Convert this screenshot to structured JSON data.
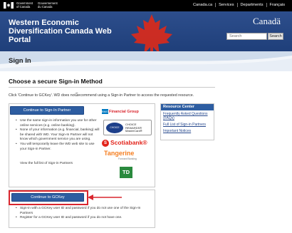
{
  "gov": {
    "en_line1": "Government",
    "en_line2": "of Canada",
    "fr_line1": "Gouvernement",
    "fr_line2": "du Canada",
    "links": [
      "Canada.ca",
      "Services",
      "Departments",
      "Français"
    ]
  },
  "banner": {
    "title": "Western Economic Diversification Canada Web Portal",
    "wordmark": "Canadä",
    "search_placeholder": "Search",
    "search_button": "Search"
  },
  "page": {
    "heading": "Sign In",
    "subtitle": "Choose a secure Sign-in Method",
    "intro": "Click 'Continue to GCKey'. WD does not recommend using a Sign-in Partner to access the requested resource."
  },
  "partner_panel": {
    "button": "Continue to Sign-In Partner",
    "bullets": [
      "Use the same sign-in information you use for other online services (e.g. online banking).",
      "None of your information (e.g. financial, banking) will be shared with WD. Your Sign-In Partner will not know which government service you are using.",
      "You will temporarily leave the WD web site to use your Sign-in Partner."
    ],
    "view_list": "View the full list of Sign-in Partners",
    "logos": {
      "bmo_mark": "BMO",
      "bmo_name": "Financial Group",
      "choice_disc": "CHOICE REWARDS",
      "choice_text": "CHOICE REWARDS® MasterCard®",
      "scotia": "Scotiabank®",
      "tangerine": "Tangerine",
      "tangerine_sub": "Forward Banking",
      "td": "TD"
    }
  },
  "gckey_panel": {
    "button": "Continue to GCKey",
    "bullets": [
      "Sign-in with a GCKey user ID and password if you do not use one of the Sign-In Partners",
      "Register for a GCKey user ID and password if you do not have one."
    ]
  },
  "resource_center": {
    "title": "Resource Center",
    "links": [
      "Frequently Asked Questions (FAQs)",
      "Full List of Sign-in Partners",
      "Important Notices"
    ]
  },
  "colors": {
    "banner": "#1f3f7a",
    "button": "#2d5da1",
    "highlight": "#d9262e",
    "link": "#284a8e"
  }
}
